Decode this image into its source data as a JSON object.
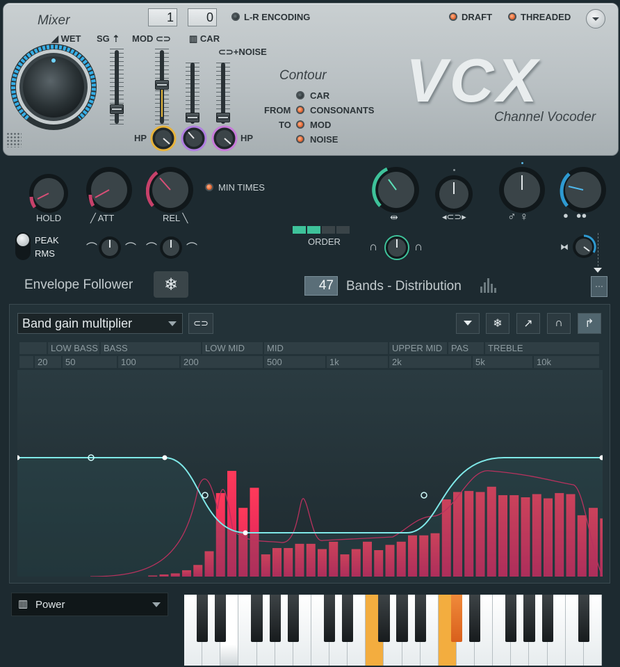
{
  "top": {
    "mixer_title": "Mixer",
    "wet_label": "WET",
    "sg_label": "SG",
    "mod_label": "MOD",
    "car_label": "CAR",
    "noise_label": "+NOISE",
    "hp_label_1": "HP",
    "hp_label_2": "HP",
    "number_left": "1",
    "number_right": "0",
    "lr_encoding": "L-R ENCODING",
    "draft": "DRAFT",
    "threaded": "THREADED",
    "contour_title": "Contour",
    "contour_car": "CAR",
    "contour_from": "FROM",
    "contour_consonants": "CONSONANTS",
    "contour_to": "TO",
    "contour_mod": "MOD",
    "contour_noise": "NOISE",
    "logo": "VCX",
    "subtitle": "Channel Vocoder"
  },
  "envelope": {
    "hold": "HOLD",
    "att": "ATT",
    "rel": "REL",
    "min_times": "MIN TIMES",
    "peak": "PEAK",
    "rms": "RMS",
    "title": "Envelope Follower"
  },
  "bands": {
    "order": "ORDER",
    "count": "47",
    "title": "Bands - Distribution"
  },
  "graph": {
    "dropdown": "Band gain multiplier",
    "ranges": [
      {
        "label": "LOW BASS"
      },
      {
        "label": "BASS"
      },
      {
        "label": "LOW MID"
      },
      {
        "label": "MID"
      },
      {
        "label": "UPPER MID"
      },
      {
        "label": "PAS"
      },
      {
        "label": "TREBLE"
      }
    ],
    "freqs": [
      "20",
      "50",
      "100",
      "200",
      "500",
      "1k",
      "2k",
      "5k",
      "10k"
    ],
    "band_levels": [
      0,
      0,
      0,
      0,
      0,
      0.01,
      0.02,
      0.03,
      0.06,
      0.11,
      0.24,
      0.79,
      1.0,
      0.65,
      0.84,
      0.21,
      0.27,
      0.27,
      0.31,
      0.31,
      0.26,
      0.33,
      0.21,
      0.26,
      0.33,
      0.25,
      0.3,
      0.33,
      0.39,
      0.39,
      0.41,
      0.73,
      0.8,
      0.81,
      0.8,
      0.85,
      0.77,
      0.77,
      0.75,
      0.78,
      0.74,
      0.79,
      0.78,
      0.58,
      0.65,
      0.55,
      0.18,
      0.05
    ]
  },
  "bottom": {
    "source_select": "Power"
  }
}
